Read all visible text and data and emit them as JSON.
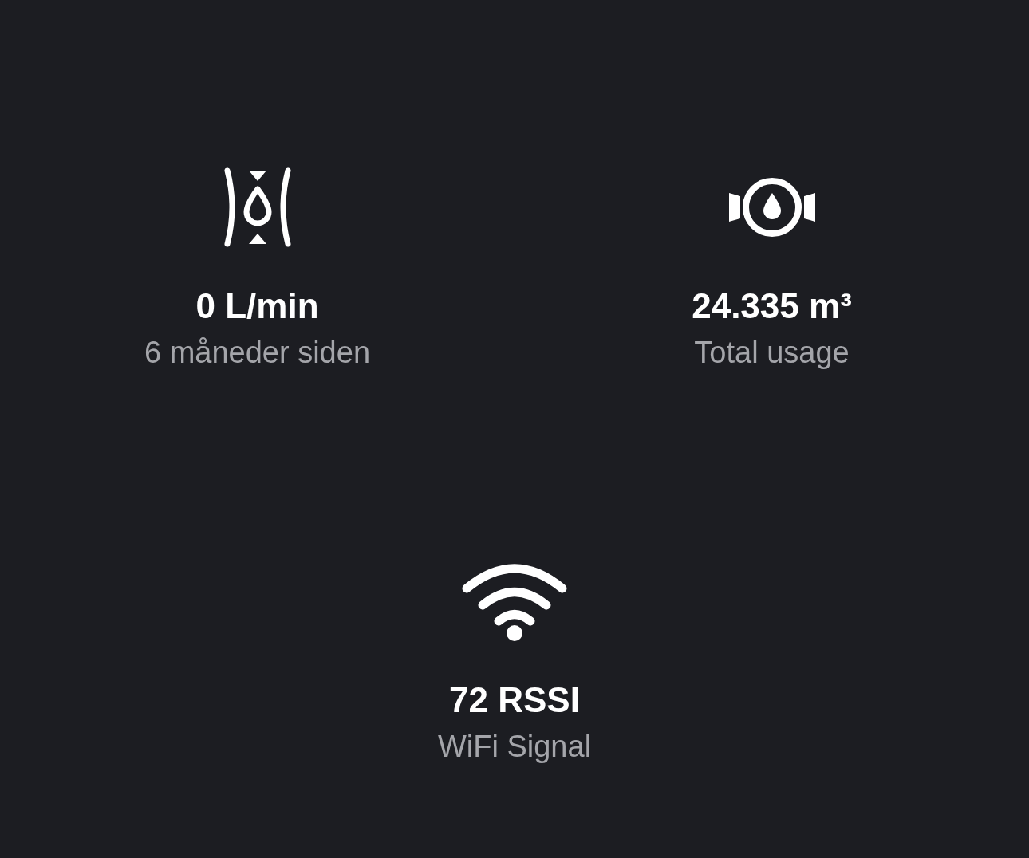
{
  "tiles": [
    {
      "kind": "flow",
      "value": "0 L/min",
      "label": "6 måneder siden"
    },
    {
      "kind": "meter",
      "value": "24.335 m³",
      "label": "Total usage"
    },
    {
      "kind": "wifi",
      "value": "72 RSSI",
      "label": "WiFi Signal"
    }
  ]
}
